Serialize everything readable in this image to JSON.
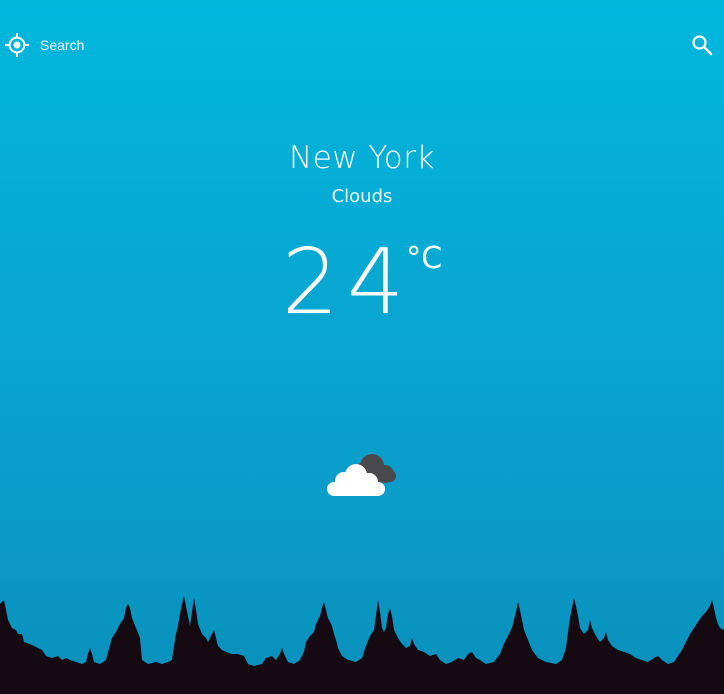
{
  "search": {
    "placeholder": "Search",
    "value": ""
  },
  "icons": {
    "locate": "my-location-icon",
    "search": "search-icon",
    "weather": "cloudy-icon",
    "skyline": "city-skyline-silhouette"
  },
  "weather": {
    "city": "New York",
    "condition": "Clouds",
    "temperature": "24",
    "unit": "°C"
  },
  "colors": {
    "background_top": "#00b7dc",
    "background_bottom": "#0a8fbb",
    "text": "#ffffff",
    "skyline": "#150a12",
    "cloud_dark": "#4a4a4d",
    "cloud_light": "#ffffff"
  }
}
